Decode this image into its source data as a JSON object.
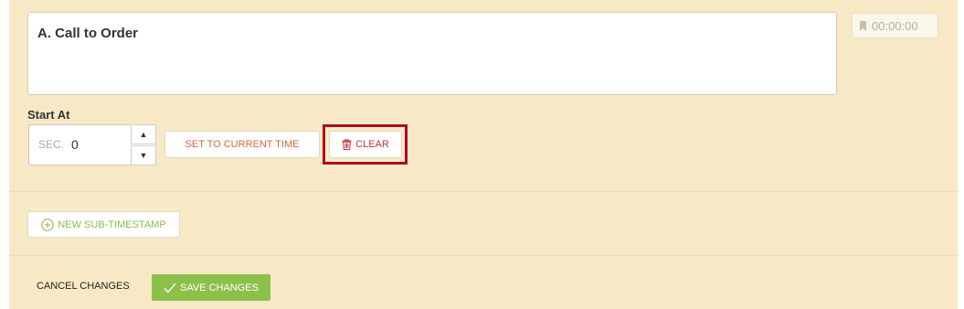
{
  "segment": {
    "title": "A. Call to Order",
    "timestamp": "00:00:00"
  },
  "start_at": {
    "label": "Start At",
    "prefix": "SEC.",
    "value": "0"
  },
  "actions": {
    "set_current": "SET TO CURRENT TIME",
    "clear": "CLEAR",
    "new_sub": "NEW SUB-TIMESTAMP",
    "cancel": "CANCEL CHANGES",
    "save": "SAVE CHANGES"
  },
  "colors": {
    "panel_bg": "#f7e9c5",
    "accent_orange": "#d0693b",
    "clear_red": "#b8373d",
    "highlight_red": "#b00d1e",
    "green": "#8dc04a"
  },
  "icons": {
    "timestamp": "bookmark-icon",
    "clear": "trash-icon",
    "new_sub": "plus-circle-icon",
    "save": "checkmark-icon",
    "step_up": "caret-up-icon",
    "step_down": "caret-down-icon"
  }
}
